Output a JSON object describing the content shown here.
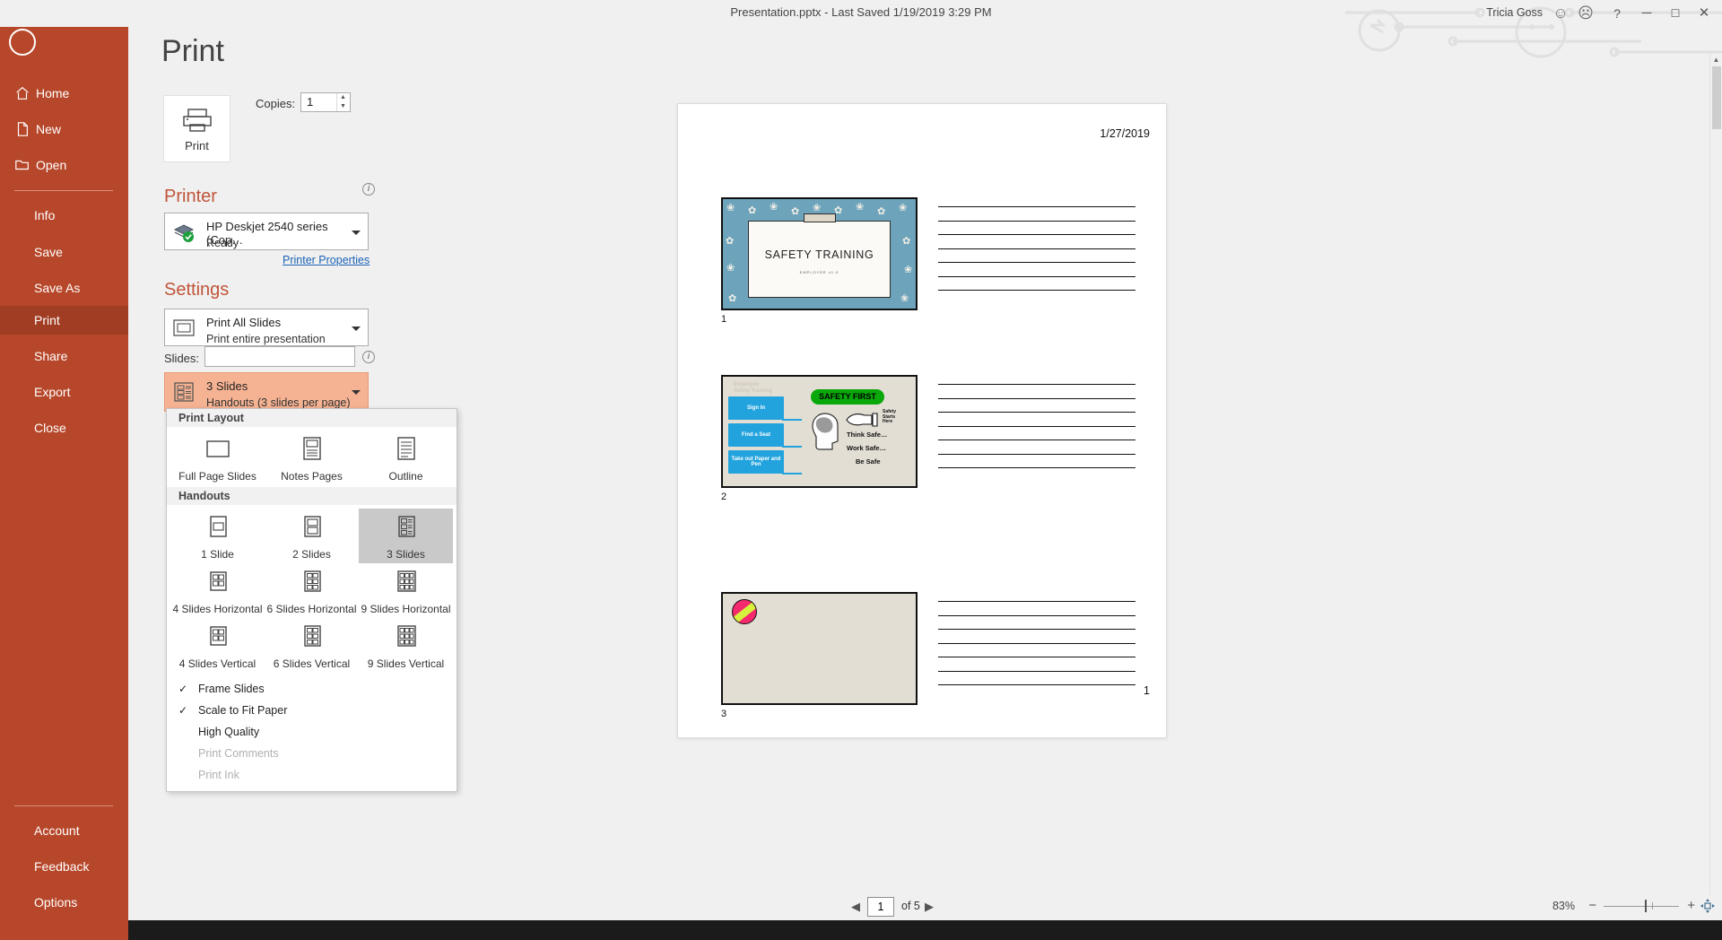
{
  "titlebar": {
    "document_title": "Presentation.pptx  -  Last Saved 1/19/2019 3:29 PM",
    "user_name": "Tricia Goss",
    "help_icon": "?",
    "minimize_icon": "─",
    "maximize_icon": "☐",
    "close_icon": "✕",
    "smile_icon": "☺",
    "frown_icon": "☹"
  },
  "rail": {
    "back_icon": "←",
    "items": [
      {
        "label": "Home",
        "icon": "home-icon",
        "active": false
      },
      {
        "label": "New",
        "icon": "page-icon",
        "active": false
      },
      {
        "label": "Open",
        "icon": "folder-icon",
        "active": false
      },
      {
        "label": "Info",
        "icon": "",
        "active": false
      },
      {
        "label": "Save",
        "icon": "",
        "active": false
      },
      {
        "label": "Save As",
        "icon": "",
        "active": false
      },
      {
        "label": "Print",
        "icon": "",
        "active": true
      },
      {
        "label": "Share",
        "icon": "",
        "active": false
      },
      {
        "label": "Export",
        "icon": "",
        "active": false
      },
      {
        "label": "Close",
        "icon": "",
        "active": false
      },
      {
        "label": "Account",
        "icon": "",
        "active": false
      },
      {
        "label": "Feedback",
        "icon": "",
        "active": false
      },
      {
        "label": "Options",
        "icon": "",
        "active": false
      }
    ]
  },
  "settings": {
    "page_title": "Print",
    "print_button_label": "Print",
    "copies_label": "Copies:",
    "copies_value": "1",
    "printer_heading": "Printer",
    "printer_name": "HP Deskjet 2540 series (Cop…",
    "printer_status": "Ready",
    "printer_properties_link": "Printer Properties",
    "settings_heading": "Settings",
    "print_range_title": "Print All Slides",
    "print_range_sub": "Print entire presentation",
    "slides_label": "Slides:",
    "slides_value": "",
    "layout_title": "3 Slides",
    "layout_sub": "Handouts (3 slides per page)",
    "info_icon": "i"
  },
  "layout_menu": {
    "print_layout_header": "Print Layout",
    "handouts_header": "Handouts",
    "print_layout_items": [
      {
        "label": "Full Page Slides",
        "selected": false
      },
      {
        "label": "Notes Pages",
        "selected": false
      },
      {
        "label": "Outline",
        "selected": false
      }
    ],
    "handout_items": [
      {
        "label": "1 Slide",
        "selected": false
      },
      {
        "label": "2 Slides",
        "selected": false
      },
      {
        "label": "3 Slides",
        "selected": true
      },
      {
        "label": "4 Slides Horizontal",
        "selected": false
      },
      {
        "label": "6 Slides Horizontal",
        "selected": false
      },
      {
        "label": "9 Slides Horizontal",
        "selected": false
      },
      {
        "label": "4 Slides Vertical",
        "selected": false
      },
      {
        "label": "6 Slides Vertical",
        "selected": false
      },
      {
        "label": "9 Slides Vertical",
        "selected": false
      }
    ],
    "options": [
      {
        "label": "Frame Slides",
        "checked": true,
        "disabled": false,
        "accel": "F"
      },
      {
        "label": "Scale to Fit Paper",
        "checked": true,
        "disabled": false,
        "accel": "S"
      },
      {
        "label": "High Quality",
        "checked": false,
        "disabled": false,
        "accel": "H"
      },
      {
        "label": "Print Comments",
        "checked": false,
        "disabled": true,
        "accel": ""
      },
      {
        "label": "Print Ink",
        "checked": false,
        "disabled": true,
        "accel": ""
      }
    ],
    "check_glyph": "✓"
  },
  "preview": {
    "handout_date": "1/27/2019",
    "handout_page_number": "1",
    "slides": [
      {
        "number": "1",
        "title": "SAFETY TRAINING",
        "subtitle": "EMPLOYEE    v1.0"
      },
      {
        "number": "2",
        "title": "Employee\nSafety Training",
        "chips": [
          "Sign In",
          "Find a Seat",
          "Take out Paper and Pen"
        ],
        "badge": "SAFETY FIRST",
        "safety_starts_here": "Safety\nStarts\nHere",
        "lines": [
          "Think Safe…",
          "Work Safe…",
          "Be Safe"
        ]
      },
      {
        "number": "3",
        "title": ""
      }
    ]
  },
  "statusbar": {
    "prev_icon": "◀",
    "next_icon": "▶",
    "page_value": "1",
    "of_text": "of 5",
    "zoom_percent": "83%",
    "zoom_out_icon": "−",
    "zoom_in_icon": "+",
    "fit_icon": "fit-to-window-icon"
  },
  "colors": {
    "brand_red": "#b7472a",
    "brand_red_active": "#a03d23",
    "accent_orange": "#c0553a",
    "highlight_peach": "#f6b393",
    "safety_green": "#0aa80a",
    "chip_blue": "#22a3dd"
  }
}
